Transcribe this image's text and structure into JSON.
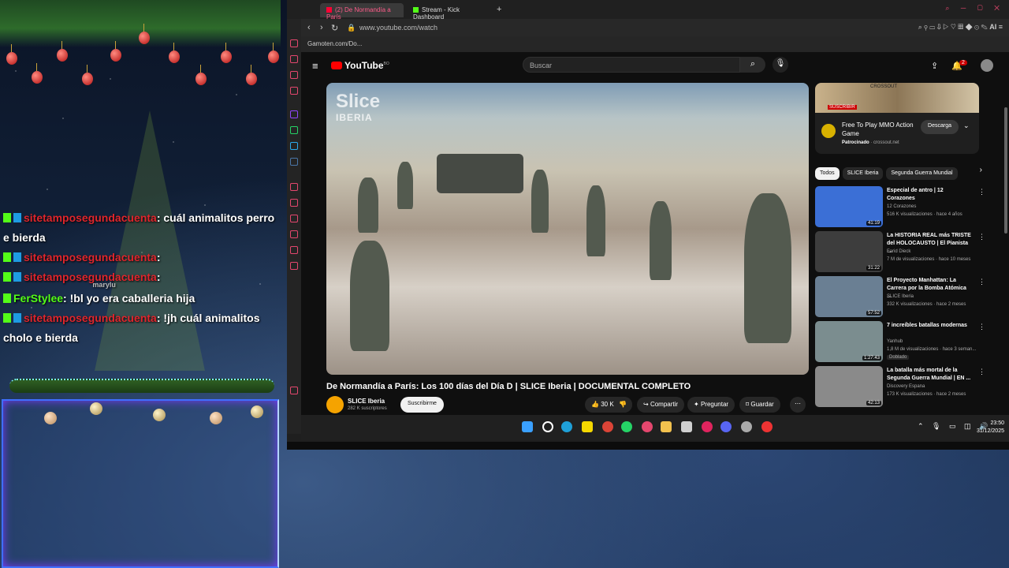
{
  "chat": {
    "messages": [
      {
        "user": "sitetamposegundacuenta",
        "text": ": cuál animalitos perro e bierda"
      },
      {
        "user": "sitetamposegundacuenta",
        "text": ":"
      },
      {
        "user": "sitetamposegundacuenta",
        "text": ":"
      },
      {
        "user": "FerStylee",
        "text": ": !bl yo era caballeria hija"
      },
      {
        "user": "sitetamposegundacuenta",
        "text": ": !jh cuál animalitos cholo e bierda"
      }
    ],
    "stray_label": "marylu"
  },
  "browser": {
    "tabs": [
      {
        "label": "(2) De Normandía a París"
      },
      {
        "label": "Stream - Kick Dashboard"
      }
    ],
    "new_tab": "+",
    "url": "www.youtube.com/watch",
    "bookmark": "Gamoten.com/Do...",
    "ext_ai": "AI"
  },
  "youtube": {
    "logo": "YouTube",
    "logo_country": "BO",
    "search_placeholder": "Buscar",
    "notif_count": "2",
    "video": {
      "title": "De Normandía a París: Los 100 días del Día D | SLICE Iberia | DOCUMENTAL COMPLETO",
      "watermark": "Slice",
      "watermark_sub": "IBERIA",
      "channel": "SLICE Iberia",
      "subscribers": "282 K suscriptores",
      "subscribe": "Suscribirme",
      "likes": "30 K",
      "share": "Compartir",
      "ask": "Preguntar",
      "save": "Guardar"
    },
    "ad": {
      "brand": "CROSSOUT",
      "banner_cta": "SUSCRIBIR",
      "title": "Free To Play MMO Action Game",
      "sponsored": "Patrocinado",
      "domain": "crossout.net",
      "button": "Descarga"
    },
    "chips": [
      "Todos",
      "SLICE Iberia",
      "Segunda Guerra Mundial"
    ],
    "recommendations": [
      {
        "title": "Especial de antro | 12 Corazones",
        "channel": "12 Corazones",
        "meta": "516 K visualizaciones · hace 4 años",
        "duration": "41:19",
        "thumb_color": "#3b6fd6",
        "tag": ""
      },
      {
        "title": "La HISTORIA REAL más TRISTE del HOLOCAUSTO | El Pianista ...",
        "channel": "Farid Dieck",
        "meta": "7 M de visualizaciones · hace 10 meses",
        "duration": "31:22",
        "thumb_color": "#3d3d3d",
        "tag": ""
      },
      {
        "title": "El Proyecto Manhattan: La Carrera por la Bomba Atómica ...",
        "channel": "SLICE Iberia",
        "meta": "332 K visualizaciones · hace 2 meses",
        "duration": "57:52",
        "thumb_color": "#6a7f93",
        "tag": ""
      },
      {
        "title": "7 increíbles batallas modernas",
        "channel": "Yanhub",
        "meta": "1,8 M de visualizaciones · hace 3 seman...",
        "duration": "1:27:43",
        "thumb_color": "#7b8d8f",
        "tag": "Doblado"
      },
      {
        "title": "La batalla más mortal de la Segunda Guerra Mundial | EN ...",
        "channel": "Discovery Espana",
        "meta": "173 K visualizaciones · hace 2 meses",
        "duration": "42:13",
        "thumb_color": "#8a8a8a",
        "tag": ""
      }
    ]
  },
  "taskbar": {
    "time": "23:50",
    "date": "31/12/2025"
  },
  "colors": {
    "kick_green": "#53fc18",
    "chat_red": "#e0252c",
    "youtube_red": "#ff0000",
    "browser_accent": "#e4476e"
  }
}
